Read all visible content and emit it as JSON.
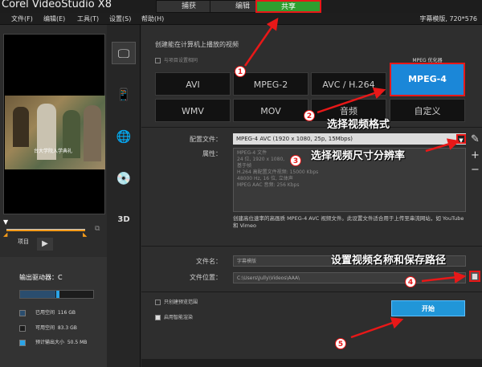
{
  "app": {
    "title": "Corel VideoStudio X8"
  },
  "tabs": [
    {
      "label": "捕获"
    },
    {
      "label": "编辑"
    },
    {
      "label": "共享"
    }
  ],
  "menu": [
    {
      "label": "文件(F)"
    },
    {
      "label": "编辑(E)"
    },
    {
      "label": "工具(T)"
    },
    {
      "label": "设置(S)"
    },
    {
      "label": "帮助(H)"
    }
  ],
  "subtitle_info": "字幕模版, 720*576",
  "preview": {
    "caption": "台大学院入学典礼"
  },
  "project_label": "项目",
  "drive": {
    "title": "输出驱动器：C",
    "used_fraction": 0.48,
    "legend": [
      {
        "label": "已用空间",
        "value": "116 GB",
        "color": "#2a4d6e"
      },
      {
        "label": "可用空间",
        "value": "83.3 GB",
        "color": "#1c1c1c"
      },
      {
        "label": "预计输出大小",
        "value": "50.5 MB",
        "color": "#2aa4e8"
      }
    ]
  },
  "main": {
    "header": "创建能在计算机上播放的视频",
    "similar_checkbox": "与项目设置相同",
    "optimizer_label": "MPEG 优化器",
    "formats": [
      {
        "label": "AVI"
      },
      {
        "label": "MPEG-2"
      },
      {
        "label": "AVC / H.264"
      },
      {
        "label": "MPEG-4",
        "selected": true
      },
      {
        "label": "WMV"
      },
      {
        "label": "MOV"
      },
      {
        "label": "音频"
      },
      {
        "label": "自定义"
      }
    ],
    "profile_label": "配置文件：",
    "profile_value": "MPEG-4 AVC (1920 x 1080, 25p, 15Mbps)",
    "props_label": "属性：",
    "props_lines": [
      "MPEG-4 文件",
      "24 位, 1920 x 1080,",
      "基于帧",
      "H.264 高配置文件视频: 15000 Kbps",
      "48000 Hz, 16 位, 立体声",
      "MPEG AAC 音频: 256 Kbps"
    ],
    "description": "创建高位速率的高画质 MPEG-4 AVC 视频文件。此设置文件适合用于上传至串流网站，如 YouTube 和 Vimeo",
    "filename_label": "文件名：",
    "filename_value": "字幕模版",
    "location_label": "文件位置：",
    "location_value": "C:\\Users\\Jully\\Videos\\AAA\\",
    "chk_preview": "只创建预览范围",
    "chk_smart": "启用智能渲染",
    "start_label": "开始"
  },
  "annotations": [
    {
      "num": "1"
    },
    {
      "num": "2",
      "text": "选择视频格式"
    },
    {
      "num": "3",
      "text": "选择视频尺寸分辨率"
    },
    {
      "num": "4",
      "text": "设置视频名称和保存路径"
    },
    {
      "num": "5"
    }
  ],
  "icons": [
    "monitor-icon",
    "device-icon",
    "globe-icon",
    "disc-icon",
    "3d-icon",
    "folder-icon",
    "pencil-icon",
    "plus-icon",
    "minus-icon",
    "play-icon"
  ]
}
